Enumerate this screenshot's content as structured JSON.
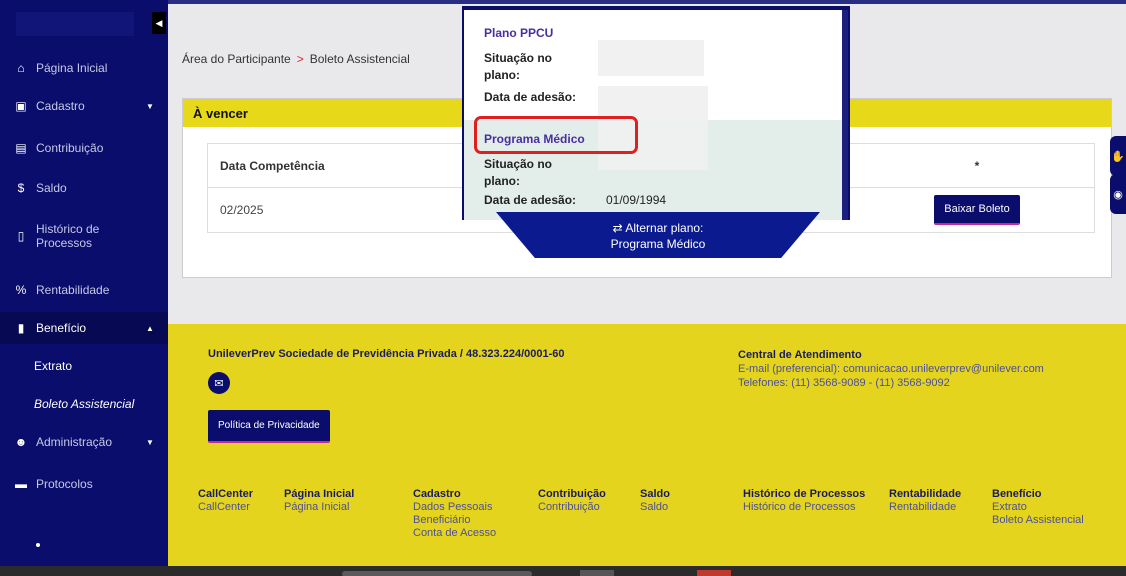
{
  "sidebar": {
    "items": [
      {
        "label": "Página Inicial",
        "icon": "home-icon"
      },
      {
        "label": "Cadastro",
        "icon": "id-card-icon"
      },
      {
        "label": "Contribuição",
        "icon": "calculator-icon"
      },
      {
        "label": "Saldo",
        "icon": "dollar-icon"
      },
      {
        "label": "Histórico de",
        "label2": "Processos",
        "icon": "document-icon"
      },
      {
        "label": "Rentabilidade",
        "icon": "percent-icon"
      },
      {
        "label": "Benefício",
        "icon": "clipboard-icon"
      },
      {
        "label": "Administração",
        "icon": "users-icon"
      },
      {
        "label": "Protocolos",
        "icon": "archive-icon"
      }
    ],
    "sub_items": [
      "Extrato",
      "Boleto Assistencial"
    ]
  },
  "breadcrumb": {
    "root": "Área do Participante",
    "sep": ">",
    "current": "Boleto Assistencial"
  },
  "card": {
    "title": "À vencer",
    "col1": "Data Competência",
    "col3": "*",
    "row_date": "02/2025",
    "button": "Baixar Boleto"
  },
  "popup": {
    "plan1": {
      "title": "Plano PPCU",
      "label_situacao_1": "Situação no",
      "label_situacao_2": "plano:",
      "label_adesao": "Data de adesão:"
    },
    "plan2": {
      "title": "Programa Médico",
      "label_situacao_1": "Situação no",
      "label_situacao_2": "plano:",
      "label_adesao": "Data de adesão:",
      "adesao_value": "01/09/1994"
    }
  },
  "alternar": {
    "label": "Alternar plano:",
    "plan": "Programa Médico"
  },
  "footer": {
    "company": "UnileverPrev Sociedade de Previdência Privada / 48.323.224/0001-60",
    "privacy": "Política de Privacidade",
    "central_title": "Central de Atendimento",
    "email": "E-mail (preferencial): comunicacao.unileverprev@unilever.com",
    "phones": "Telefones: (11) 3568-9089 - (11) 3568-9092",
    "columns": [
      {
        "title": "CallCenter",
        "links": [
          "CallCenter"
        ]
      },
      {
        "title": "Página Inicial",
        "links": [
          "Página Inicial"
        ]
      },
      {
        "title": "Cadastro",
        "links": [
          "Dados Pessoais",
          "Beneficiário",
          "Conta de Acesso"
        ]
      },
      {
        "title": "Contribuição",
        "links": [
          "Contribuição"
        ]
      },
      {
        "title": "Saldo",
        "links": [
          "Saldo"
        ]
      },
      {
        "title": "Histórico de Processos",
        "links": [
          "Histórico de Processos"
        ]
      },
      {
        "title": "Rentabilidade",
        "links": [
          "Rentabilidade"
        ]
      },
      {
        "title": "Benefício",
        "links": [
          "Extrato",
          "Boleto Assistencial"
        ]
      }
    ]
  },
  "colors": {
    "navy": "#0a0d6b",
    "yellow": "#e4d41e",
    "highlight": "#e02020",
    "purple": "#4a2ea0"
  }
}
